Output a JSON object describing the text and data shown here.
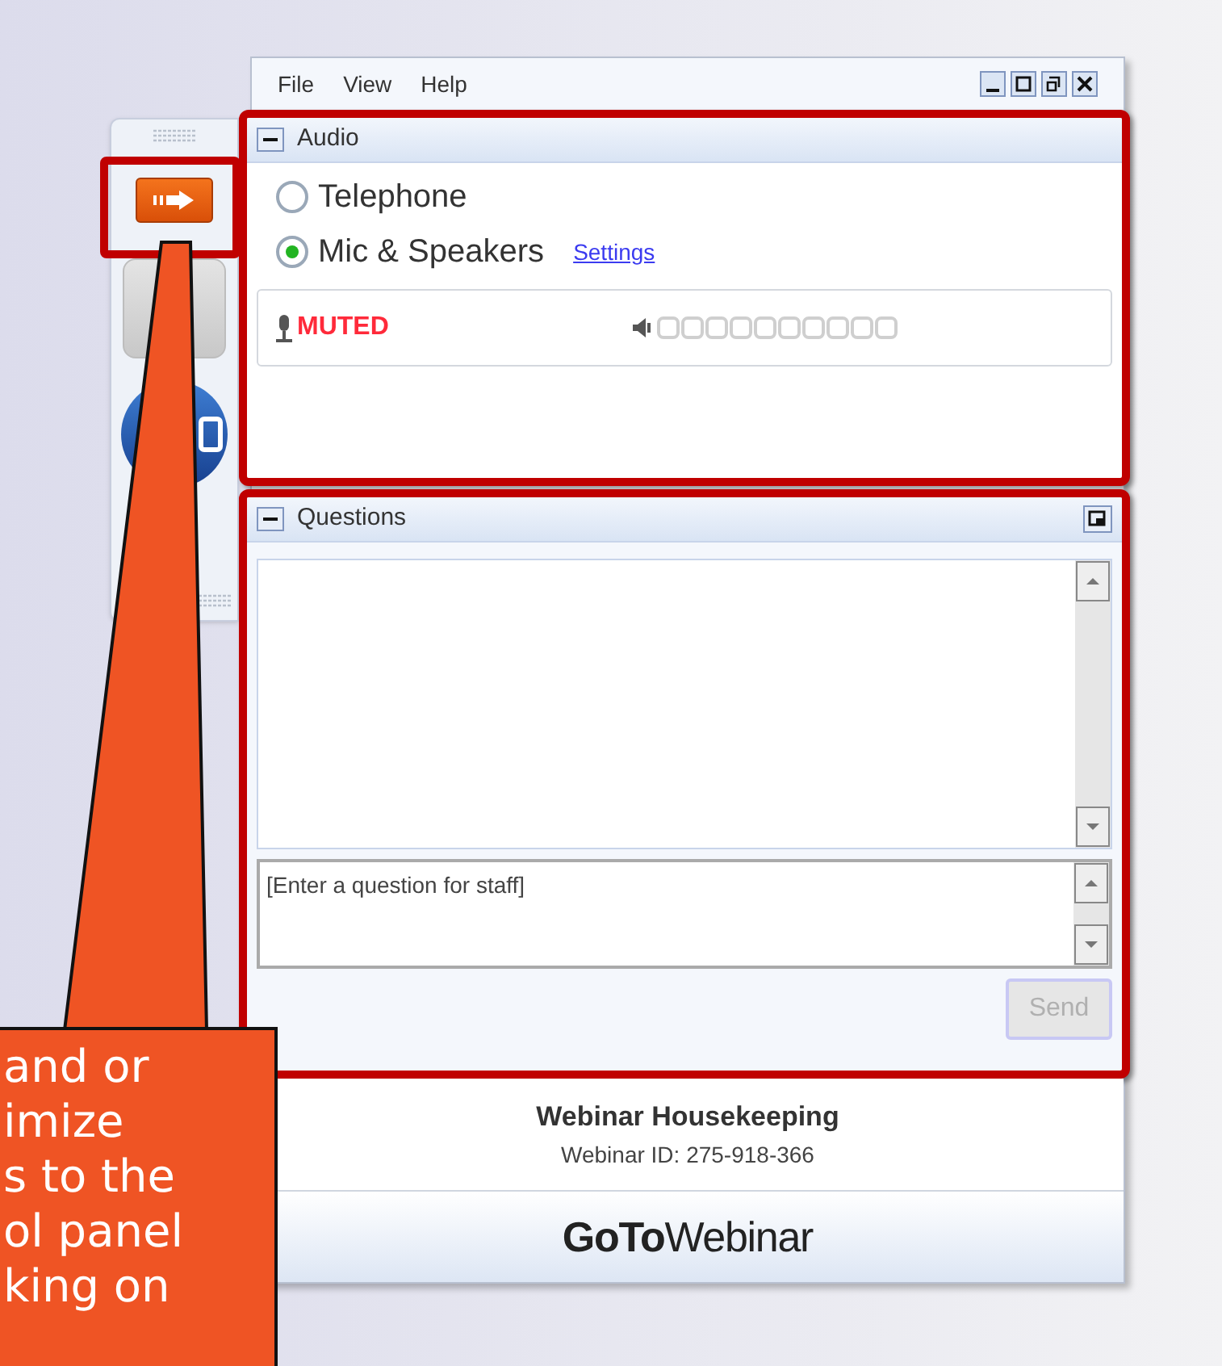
{
  "menu": [
    "File",
    "View",
    "Help"
  ],
  "audio": {
    "title": "Audio",
    "options": [
      {
        "label": "Telephone",
        "selected": false
      },
      {
        "label": "Mic & Speakers",
        "selected": true
      }
    ],
    "settings_link": "Settings",
    "mic_status": "MUTED"
  },
  "questions": {
    "title": "Questions",
    "input": {
      "placeholder": "[Enter a question for staff]"
    },
    "send": {
      "label": "Send",
      "disabled": true
    }
  },
  "footer": {
    "title": "Webinar Housekeeping",
    "webinar_id": "Webinar ID: 275-918-366",
    "brand": "**GoTo**Webinar"
  },
  "callout": {
    "lines": [
      "and or",
      "imize",
      "s to the",
      "ol panel",
      "king on"
    ]
  }
}
